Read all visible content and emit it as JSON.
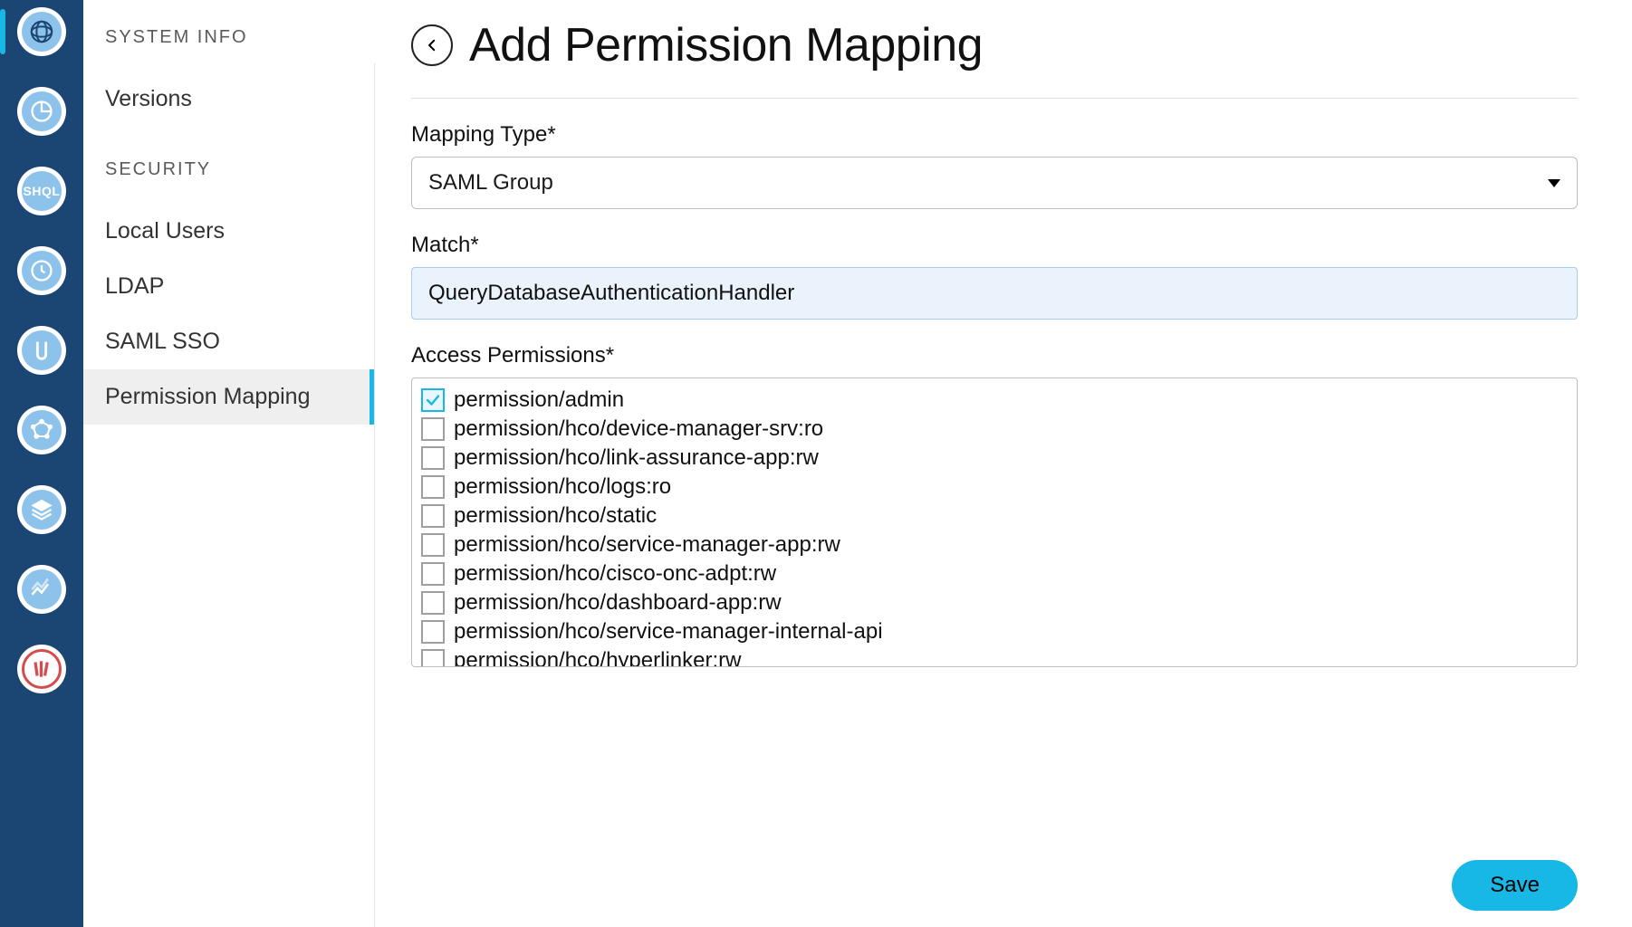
{
  "rail": {
    "items": [
      {
        "name": "globe-icon",
        "active": true
      },
      {
        "name": "pie-icon",
        "active": false
      },
      {
        "name": "shql-icon",
        "active": false,
        "text": "SHQL"
      },
      {
        "name": "clock-icon",
        "active": false
      },
      {
        "name": "link-icon",
        "active": false
      },
      {
        "name": "topology-icon",
        "active": false
      },
      {
        "name": "layers-icon",
        "active": false
      },
      {
        "name": "analytics-icon",
        "active": false
      },
      {
        "name": "library-icon",
        "active": false,
        "red": true
      }
    ]
  },
  "sidebar": {
    "groups": [
      {
        "header": "SYSTEM INFO",
        "items": [
          {
            "label": "Versions",
            "active": false
          }
        ]
      },
      {
        "header": "SECURITY",
        "items": [
          {
            "label": "Local Users",
            "active": false
          },
          {
            "label": "LDAP",
            "active": false
          },
          {
            "label": "SAML SSO",
            "active": false
          },
          {
            "label": "Permission Mapping",
            "active": true
          }
        ]
      }
    ]
  },
  "page": {
    "title": "Add Permission Mapping",
    "mapping_type_label": "Mapping Type*",
    "mapping_type_value": "SAML Group",
    "match_label": "Match*",
    "match_value": "QueryDatabaseAuthenticationHandler",
    "access_label": "Access Permissions*",
    "permissions": [
      {
        "label": "permission/admin",
        "checked": true
      },
      {
        "label": "permission/hco/device-manager-srv:ro",
        "checked": false
      },
      {
        "label": "permission/hco/link-assurance-app:rw",
        "checked": false
      },
      {
        "label": "permission/hco/logs:ro",
        "checked": false
      },
      {
        "label": "permission/hco/static",
        "checked": false
      },
      {
        "label": "permission/hco/service-manager-app:rw",
        "checked": false
      },
      {
        "label": "permission/hco/cisco-onc-adpt:rw",
        "checked": false
      },
      {
        "label": "permission/hco/dashboard-app:rw",
        "checked": false
      },
      {
        "label": "permission/hco/service-manager-internal-api",
        "checked": false
      },
      {
        "label": "permission/hco/hyperlinker:rw",
        "checked": false
      }
    ],
    "save_label": "Save"
  }
}
